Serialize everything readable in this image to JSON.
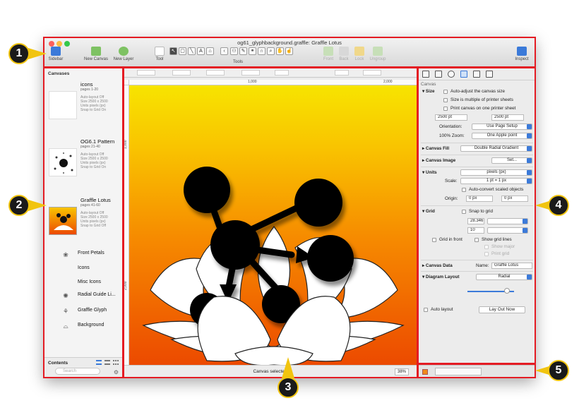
{
  "window": {
    "title": "og61_glyphbackground.graffle: Graffle Lotus"
  },
  "toolbar": {
    "sidebar": "Sidebar",
    "new_canvas": "New Canvas",
    "new_layer": "New Layer",
    "tool": "Tool",
    "tools": "Tools",
    "front": "Front",
    "back": "Back",
    "lock": "Lock",
    "ungroup": "Ungroup",
    "inspect": "Inspect"
  },
  "sidebar": {
    "header": "Canvases",
    "canvases": [
      {
        "name": "icons",
        "pages": "pages 1-20",
        "auto_layout": "Auto-layout Off",
        "size": "Size 2500 x 2500",
        "units": "Units pixels (px)",
        "snap": "Snap to Grid On"
      },
      {
        "name": "OG6.1 Pattern",
        "pages": "pages 21-40",
        "auto_layout": "Auto-layout Off",
        "size": "Size 2500 x 2500",
        "units": "Units pixels (px)",
        "snap": "Snap to Grid On"
      },
      {
        "name": "Graffle Lotus",
        "pages": "pages 41-60",
        "auto_layout": "Auto-layout Off",
        "size": "Size 2500 x 2500",
        "units": "Units pixels (px)",
        "snap": "Snap to Grid Off"
      }
    ],
    "layers": [
      {
        "name": "Front Petals"
      },
      {
        "name": "Icons"
      },
      {
        "name": "Misc Icons"
      },
      {
        "name": "Radial Guide Li..."
      },
      {
        "name": "Graffle Glyph"
      },
      {
        "name": "Background"
      }
    ],
    "contents_label": "Contents",
    "search_placeholder": "Search"
  },
  "canvas": {
    "ruler_labels": [
      "1,000",
      "2,000"
    ],
    "ruler_v_labels": [
      "1,000",
      "2,000"
    ],
    "status": "Canvas selected",
    "zoom": "38%"
  },
  "inspector": {
    "section_title": "Canvas",
    "size": {
      "label": "Size",
      "auto_adjust": "Auto-adjust the canvas size",
      "multiple_sheets": "Size is multiple of printer sheets",
      "print_one_page": "Print canvas on one printer sheet",
      "width": "2500 pt",
      "height": "2500 pt",
      "orientation_label": "Orientation:",
      "orientation_value": "Use Page Setup",
      "zoom_label": "100% Zoom:",
      "zoom_value": "One Apple point"
    },
    "canvas_fill": {
      "label": "Canvas Fill",
      "value": "Double Radial Gradient"
    },
    "canvas_image": {
      "label": "Canvas Image",
      "value": "Set..."
    },
    "units": {
      "label": "Units",
      "value": "pixels (px)",
      "scale_label": "Scale:",
      "scale_value": "1 pt = 1 px",
      "auto_convert": "Auto-convert scaled objects",
      "origin_label": "Origin:",
      "origin_x": "0 px",
      "origin_y": "0 px"
    },
    "grid": {
      "label": "Grid",
      "snap": "Snap to grid",
      "major": "28.346",
      "minor": "10",
      "grid_in_front": "Grid in front",
      "show_grid_lines": "Show grid lines",
      "show_major": "Show major",
      "print_grid": "Print grid"
    },
    "canvas_data": {
      "label": "Canvas Data",
      "name_label": "Name:",
      "name_value": "Graffle Lotus"
    },
    "diagram_layout": {
      "label": "Diagram Layout",
      "value": "Radial",
      "auto_layout": "Auto layout",
      "layout_now": "Lay Out Now"
    }
  },
  "callouts": [
    "1",
    "2",
    "3",
    "4",
    "5"
  ],
  "colors": {
    "highlight": "#e41b23",
    "callout_ring": "#f1c40f",
    "accent": "#3b7ad9",
    "canvas_top": "#f7e400",
    "canvas_bottom": "#ec4a00"
  }
}
